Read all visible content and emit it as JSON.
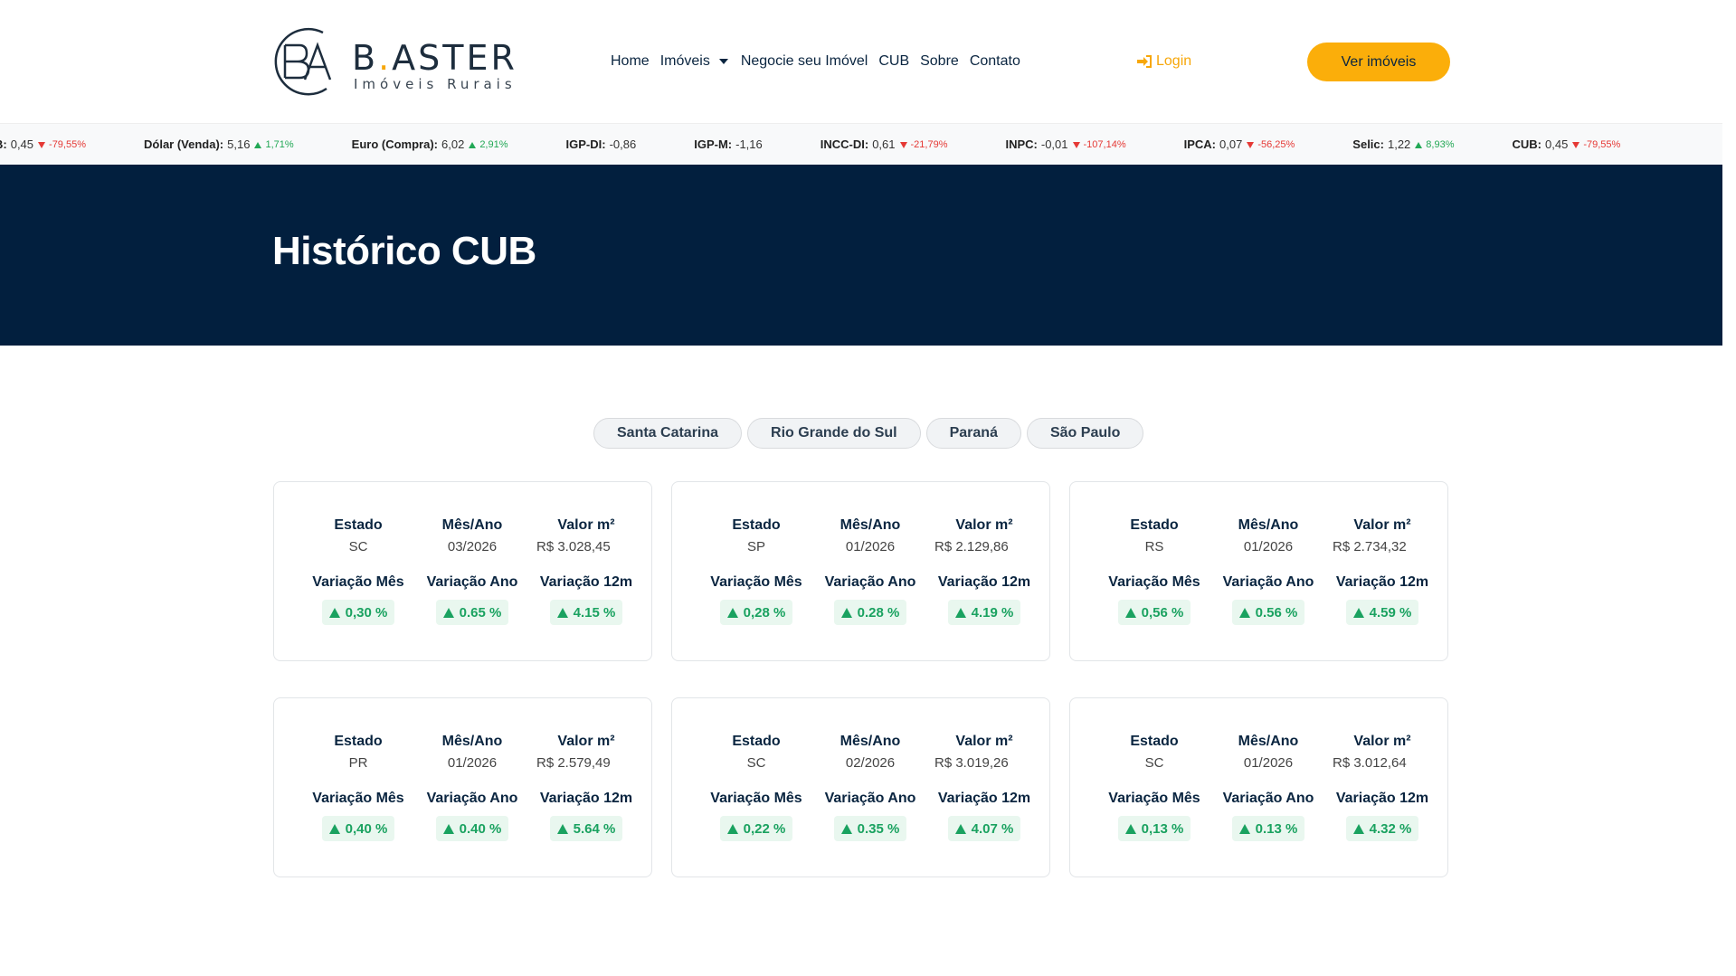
{
  "header": {
    "logo": {
      "name_prefix": "B",
      "name_dot": ".",
      "name_suffix": "ASTER",
      "subtitle": "Imóveis Rurais"
    },
    "nav": [
      "Home",
      "Imóveis",
      "Negocie seu Imóvel",
      "CUB",
      "Sobre",
      "Contato"
    ],
    "login_label": "Login",
    "cta_label": "Ver imóveis"
  },
  "ticker": [
    {
      "name": "B:",
      "value": "0,45",
      "direction": "down",
      "variation": "-79,55%"
    },
    {
      "name": "Dólar (Venda):",
      "value": "5,16",
      "direction": "up",
      "variation": "1,71%"
    },
    {
      "name": "Euro (Compra):",
      "value": "6,02",
      "direction": "up",
      "variation": "2,91%"
    },
    {
      "name": "IGP-DI:",
      "value": "-0,86",
      "direction": "none",
      "variation": ""
    },
    {
      "name": "IGP-M:",
      "value": "-1,16",
      "direction": "none",
      "variation": ""
    },
    {
      "name": "INCC-DI:",
      "value": "0,61",
      "direction": "down",
      "variation": "-21,79%"
    },
    {
      "name": "INPC:",
      "value": "-0,01",
      "direction": "down",
      "variation": "-107,14%"
    },
    {
      "name": "IPCA:",
      "value": "0,07",
      "direction": "down",
      "variation": "-56,25%"
    },
    {
      "name": "Selic:",
      "value": "1,22",
      "direction": "up",
      "variation": "8,93%"
    },
    {
      "name": "CUB:",
      "value": "0,45",
      "direction": "down",
      "variation": "-79,55%"
    }
  ],
  "banner": {
    "title": "Histórico CUB"
  },
  "tabs": [
    "Santa Catarina",
    "Rio Grande do Sul",
    "Paraná",
    "São Paulo"
  ],
  "labels": {
    "estado": "Estado",
    "mes_ano": "Mês/Ano",
    "valor": "Valor m²",
    "var_mes": "Variação Mês",
    "var_ano": "Variação Ano",
    "var_12m": "Variação 12m"
  },
  "cards": [
    {
      "estado": "SC",
      "mes_ano": "03/2026",
      "valor": "R$ 3.028,45",
      "var_mes": "0,30 %",
      "var_ano": "0.65 %",
      "var_12m": "4.15 %"
    },
    {
      "estado": "SP",
      "mes_ano": "01/2026",
      "valor": "R$ 2.129,86",
      "var_mes": "0,28 %",
      "var_ano": "0.28 %",
      "var_12m": "4.19 %"
    },
    {
      "estado": "RS",
      "mes_ano": "01/2026",
      "valor": "R$ 2.734,32",
      "var_mes": "0,56 %",
      "var_ano": "0.56 %",
      "var_12m": "4.59 %"
    },
    {
      "estado": "PR",
      "mes_ano": "01/2026",
      "valor": "R$ 2.579,49",
      "var_mes": "0,40 %",
      "var_ano": "0.40 %",
      "var_12m": "5.64 %"
    },
    {
      "estado": "SC",
      "mes_ano": "02/2026",
      "valor": "R$ 3.019,26",
      "var_mes": "0,22 %",
      "var_ano": "0.35 %",
      "var_12m": "4.07 %"
    },
    {
      "estado": "SC",
      "mes_ano": "01/2026",
      "valor": "R$ 3.012,64",
      "var_mes": "0,13 %",
      "var_ano": "0.13 %",
      "var_12m": "4.32 %"
    }
  ],
  "colors": {
    "brand_navy": "#021f3e",
    "accent_yellow": "#fbae0a",
    "positive_green": "#1aa260",
    "negative_red": "#e53935"
  },
  "icons": {
    "login": "sign-in-icon",
    "nav_dropdown": "caret-down-icon",
    "variation_up": "triangle-up-icon",
    "variation_down": "triangle-down-icon"
  }
}
